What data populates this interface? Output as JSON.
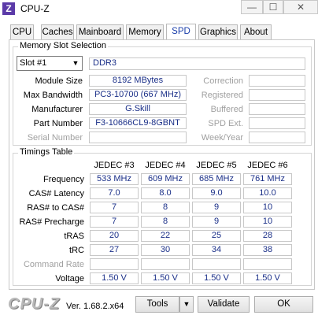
{
  "window": {
    "title": "CPU-Z",
    "app_icon_glyph": "Z",
    "minimize": "—",
    "maximize": "☐",
    "close": "✕"
  },
  "tabs": [
    {
      "label": "CPU",
      "active": false
    },
    {
      "label": "Caches",
      "active": false
    },
    {
      "label": "Mainboard",
      "active": false
    },
    {
      "label": "Memory",
      "active": false
    },
    {
      "label": "SPD",
      "active": true
    },
    {
      "label": "Graphics",
      "active": false
    },
    {
      "label": "About",
      "active": false
    }
  ],
  "slot": {
    "group_title": "Memory Slot Selection",
    "selected": "Slot #1",
    "type": "DDR3",
    "left_labels": [
      "Module Size",
      "Max Bandwidth",
      "Manufacturer",
      "Part Number",
      "Serial Number"
    ],
    "left_values": [
      "8192 MBytes",
      "PC3-10700 (667 MHz)",
      "G.Skill",
      "F3-10666CL9-8GBNT",
      ""
    ],
    "right_labels": [
      "Correction",
      "Registered",
      "Buffered",
      "SPD Ext.",
      "Week/Year"
    ],
    "right_values": [
      "",
      "",
      "",
      "",
      ""
    ]
  },
  "timings": {
    "group_title": "Timings Table",
    "columns": [
      "JEDEC #3",
      "JEDEC #4",
      "JEDEC #5",
      "JEDEC #6"
    ],
    "rows": [
      {
        "label": "Frequency",
        "values": [
          "533 MHz",
          "609 MHz",
          "685 MHz",
          "761 MHz"
        ],
        "enabled": true
      },
      {
        "label": "CAS# Latency",
        "values": [
          "7.0",
          "8.0",
          "9.0",
          "10.0"
        ],
        "enabled": true
      },
      {
        "label": "RAS# to CAS#",
        "values": [
          "7",
          "8",
          "9",
          "10"
        ],
        "enabled": true
      },
      {
        "label": "RAS# Precharge",
        "values": [
          "7",
          "8",
          "9",
          "10"
        ],
        "enabled": true
      },
      {
        "label": "tRAS",
        "values": [
          "20",
          "22",
          "25",
          "28"
        ],
        "enabled": true
      },
      {
        "label": "tRC",
        "values": [
          "27",
          "30",
          "34",
          "38"
        ],
        "enabled": true
      },
      {
        "label": "Command Rate",
        "values": [
          "",
          "",
          "",
          ""
        ],
        "enabled": false
      },
      {
        "label": "Voltage",
        "values": [
          "1.50 V",
          "1.50 V",
          "1.50 V",
          "1.50 V"
        ],
        "enabled": true
      }
    ]
  },
  "footer": {
    "logo": "CPU-Z",
    "version": "Ver. 1.68.2.x64",
    "tools_label": "Tools",
    "tools_arrow": "▼",
    "validate_label": "Validate",
    "ok_label": "OK"
  }
}
